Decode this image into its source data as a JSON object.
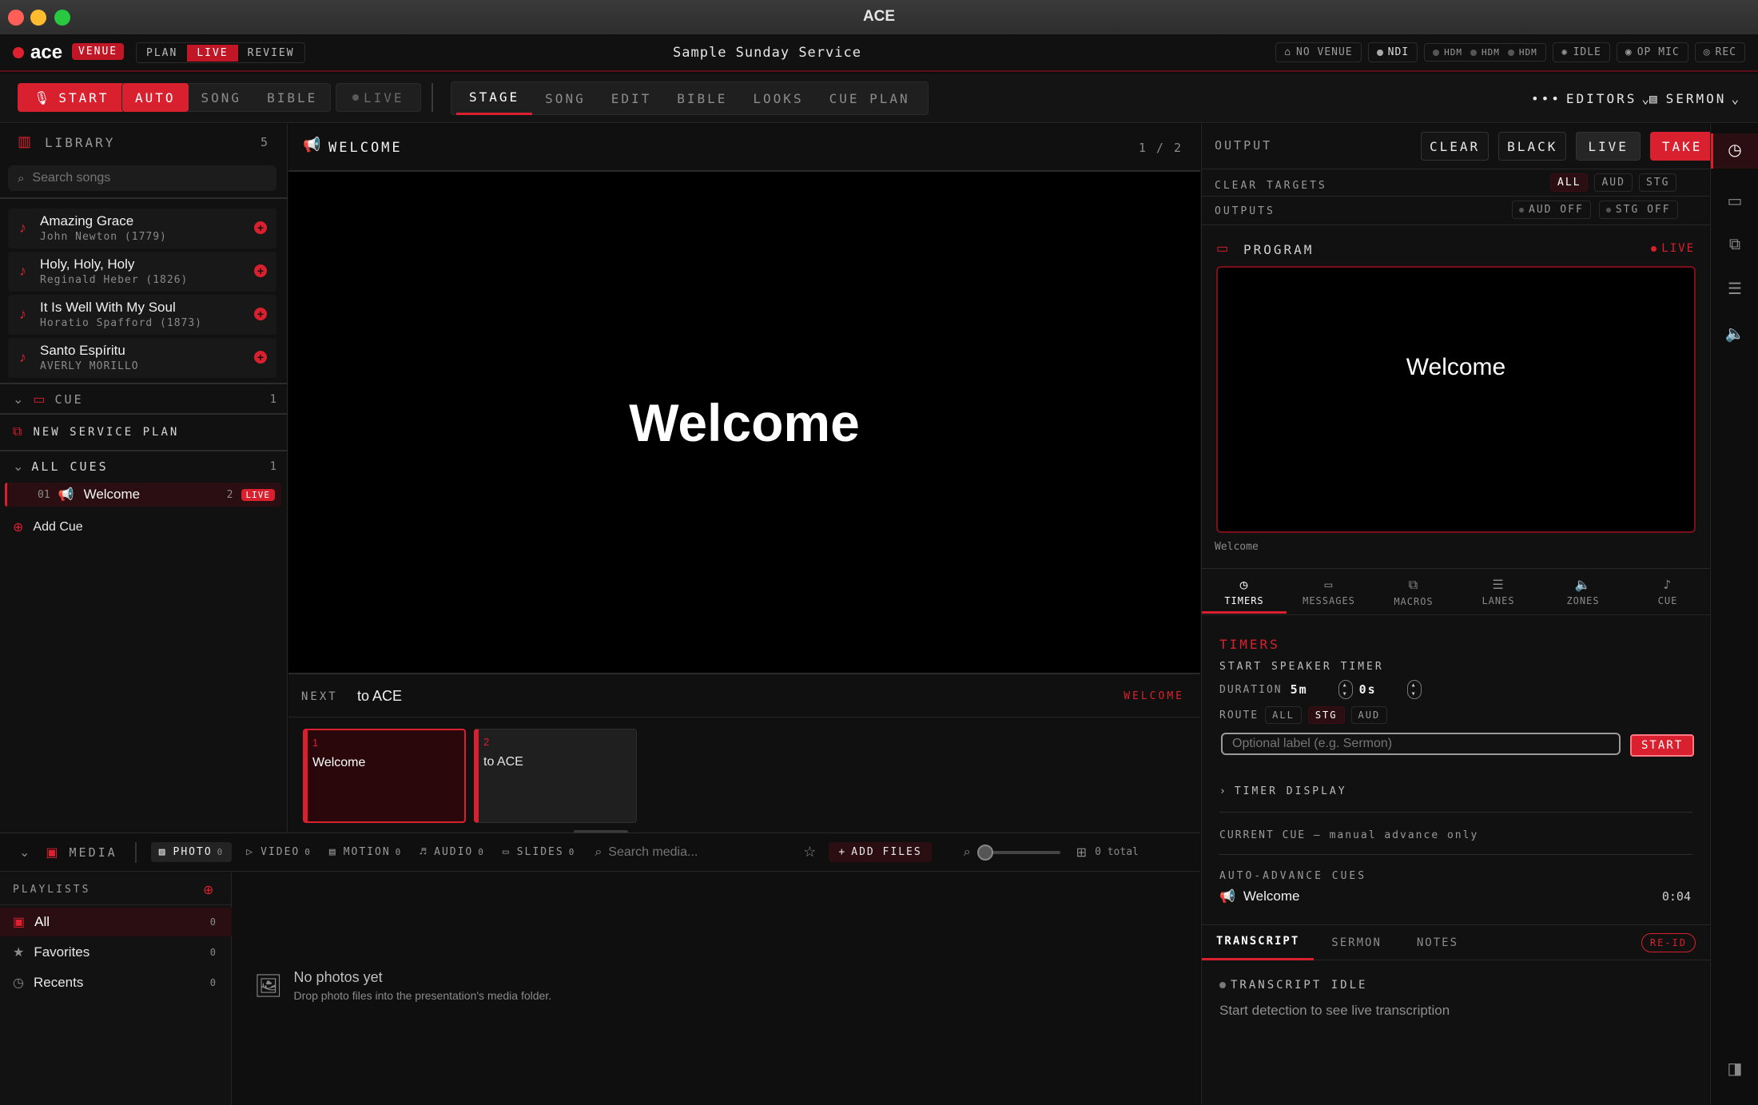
{
  "window": {
    "title": "ACE"
  },
  "appbar": {
    "logo": "ace",
    "venue_badge": "VENUE",
    "modes": [
      "PLAN",
      "LIVE",
      "REVIEW"
    ],
    "active_mode": "LIVE",
    "service_title": "Sample Sunday Service",
    "status": {
      "venue": "NO VENUE",
      "ndi": "NDI",
      "hdm": [
        "HDM",
        "HDM",
        "HDM"
      ],
      "idle": "IDLE",
      "op_mic": "OP MIC",
      "rec": "REC"
    }
  },
  "toolbar": {
    "start_label": "START",
    "source_modes": [
      "AUTO",
      "SONG",
      "BIBLE"
    ],
    "live_toggle": "LIVE",
    "view_tabs": [
      "STAGE",
      "SONG",
      "EDIT",
      "BIBLE",
      "LOOKS",
      "CUE PLAN"
    ],
    "active_view": "STAGE",
    "editors_label": "EDITORS",
    "sermon_label": "SERMON"
  },
  "library": {
    "title": "LIBRARY",
    "count": "5",
    "search_placeholder": "Search songs",
    "songs": [
      {
        "title": "Amazing Grace",
        "author": "John Newton (1779)"
      },
      {
        "title": "Holy, Holy, Holy",
        "author": "Reginald Heber (1826)"
      },
      {
        "title": "It Is Well With My Soul",
        "author": "Horatio Spafford (1873)"
      },
      {
        "title": "Santo Espíritu",
        "author": "AVERLY MORILLO"
      }
    ],
    "cue_section": {
      "label": "CUE",
      "count": "1"
    },
    "new_service_plan": "NEW SERVICE PLAN",
    "all_cues": {
      "label": "ALL CUES",
      "count": "1"
    },
    "cues": [
      {
        "num": "01",
        "title": "Welcome",
        "slides": "2",
        "badge": "LIVE"
      }
    ],
    "add_cue": "Add Cue"
  },
  "stage": {
    "header_title": "WELCOME",
    "page": "1 / 2",
    "preview_text": "Welcome",
    "next_label": "NEXT",
    "next_text": "to ACE",
    "next_section": "WELCOME",
    "slides": [
      {
        "num": "1",
        "text": "Welcome"
      },
      {
        "num": "2",
        "text": "to ACE"
      }
    ]
  },
  "media": {
    "title": "MEDIA",
    "tabs": [
      {
        "label": "PHOTO",
        "count": "0"
      },
      {
        "label": "VIDEO",
        "count": "0"
      },
      {
        "label": "MOTION",
        "count": "0"
      },
      {
        "label": "AUDIO",
        "count": "0"
      },
      {
        "label": "SLIDES",
        "count": "0"
      }
    ],
    "search_placeholder": "Search media...",
    "add_files": "ADD FILES",
    "total": "0 total",
    "playlists_label": "PLAYLISTS",
    "playlists": [
      {
        "name": "All",
        "count": "0"
      },
      {
        "name": "Favorites",
        "count": "0"
      },
      {
        "name": "Recents",
        "count": "0"
      }
    ],
    "empty_title": "No photos yet",
    "empty_sub": "Drop photo files into the presentation's media folder."
  },
  "output": {
    "title": "OUTPUT",
    "buttons": [
      "CLEAR",
      "BLACK",
      "LIVE",
      "TAKE"
    ],
    "clear_targets_label": "CLEAR TARGETS",
    "clear_targets": [
      "ALL",
      "AUD",
      "STG"
    ],
    "outputs_label": "OUTPUTS",
    "outputs": [
      "AUD OFF",
      "STG OFF"
    ],
    "program_label": "PROGRAM",
    "live_indicator": "LIVE",
    "program_text": "Welcome",
    "program_caption": "Welcome"
  },
  "tools": {
    "tabs": [
      "TIMERS",
      "MESSAGES",
      "MACROS",
      "LANES",
      "ZONES",
      "CUE"
    ],
    "active": "TIMERS",
    "timers_heading": "TIMERS",
    "start_speaker_timer": "START SPEAKER TIMER",
    "duration_label": "DURATION",
    "duration_min": "5m",
    "duration_sec": "0s",
    "route_label": "ROUTE",
    "routes": [
      "ALL",
      "STG",
      "AUD"
    ],
    "active_route": "STG",
    "label_placeholder": "Optional label (e.g. Sermon)",
    "start_button": "START",
    "timer_display": "TIMER DISPLAY",
    "current_cue": "CURRENT CUE — manual advance only",
    "auto_advance_label": "AUTO-ADVANCE CUES",
    "auto_advance_item": "Welcome",
    "auto_advance_time": "0:04"
  },
  "transcript": {
    "tabs": [
      "TRANSCRIPT",
      "SERMON",
      "NOTES"
    ],
    "active": "TRANSCRIPT",
    "reid": "RE-ID",
    "status": "TRANSCRIPT IDLE",
    "hint": "Start detection to see live transcription"
  },
  "colors": {
    "accent": "#d9202e",
    "background": "#0c0c0c",
    "panel": "#111111"
  }
}
